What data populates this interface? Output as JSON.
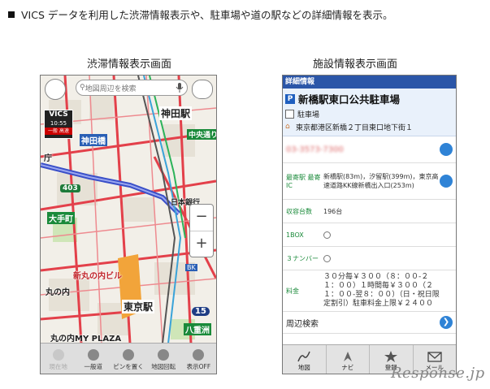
{
  "headline": "VICS データを利用した渋滞情報表示や、駐車場や道の駅などの詳細情報を表示。",
  "captions": {
    "left": "渋滞情報表示画面",
    "right": "施設情報表示画面"
  },
  "map_screen": {
    "search_placeholder": "地図周辺を検索",
    "vics": {
      "title": "VICS",
      "time": "10:55",
      "tag": "一般 高速"
    },
    "zoom_in": "+",
    "zoom_out": "−",
    "labels": {
      "kanda_station": "神田駅",
      "kandabashi": "神田橋",
      "ohtemachi": "大手町",
      "chuo_dori": "中央通り",
      "route_403": "403",
      "nihon_ginko": "日本銀行",
      "shin_marunouchi": "新丸の内ビル",
      "marunouchi": "丸の内",
      "tokyo_station": "東京駅",
      "route_15": "15",
      "yaesu": "八重洲",
      "my_plaza": "丸の内MY PLAZA",
      "bk": "BK",
      "chou": "庁"
    },
    "toolbar": [
      {
        "label": "現在地",
        "icon": "current-location-icon",
        "dim": true
      },
      {
        "label": "一般道",
        "icon": "car-icon",
        "dim": false
      },
      {
        "label": "ピンを置く",
        "icon": "pin-icon",
        "dim": false
      },
      {
        "label": "地図回転",
        "icon": "rotate-icon",
        "dim": false
      },
      {
        "label": "表示OFF",
        "icon": "display-off-icon",
        "dim": false
      }
    ]
  },
  "detail_screen": {
    "header": "詳細情報",
    "facility_name": "新橋駅東口公共駐車場",
    "category": "駐車場",
    "address": "東京都港区新橋２丁目東口地下街１",
    "phone_blurred": "03-3573-7300",
    "rows": [
      {
        "key": "最寄駅 最寄IC",
        "value": "新橋駅(83m)，汐留駅(399m)，東京高速道路KK線新橋出入口(253m)",
        "type": "list"
      },
      {
        "key": "収容台数",
        "value": "196台",
        "type": "text"
      },
      {
        "key": "1BOX",
        "value": "",
        "type": "circle"
      },
      {
        "key": "３ナンバー",
        "value": "",
        "type": "circle"
      },
      {
        "key": "料金",
        "value": "３０分毎￥３００（８：００-２１：００）１時間毎￥３００（２１：００-翌８：００）（日・祝日限定割引）駐車料金上限￥２４００",
        "type": "text"
      }
    ],
    "nearby": "周辺検索",
    "toolbar": [
      {
        "label": "地図",
        "icon": "map-icon"
      },
      {
        "label": "ナビ",
        "icon": "navi-icon"
      },
      {
        "label": "登録",
        "icon": "star-icon"
      },
      {
        "label": "メール",
        "icon": "mail-icon"
      }
    ]
  },
  "watermark": "Response.jp"
}
